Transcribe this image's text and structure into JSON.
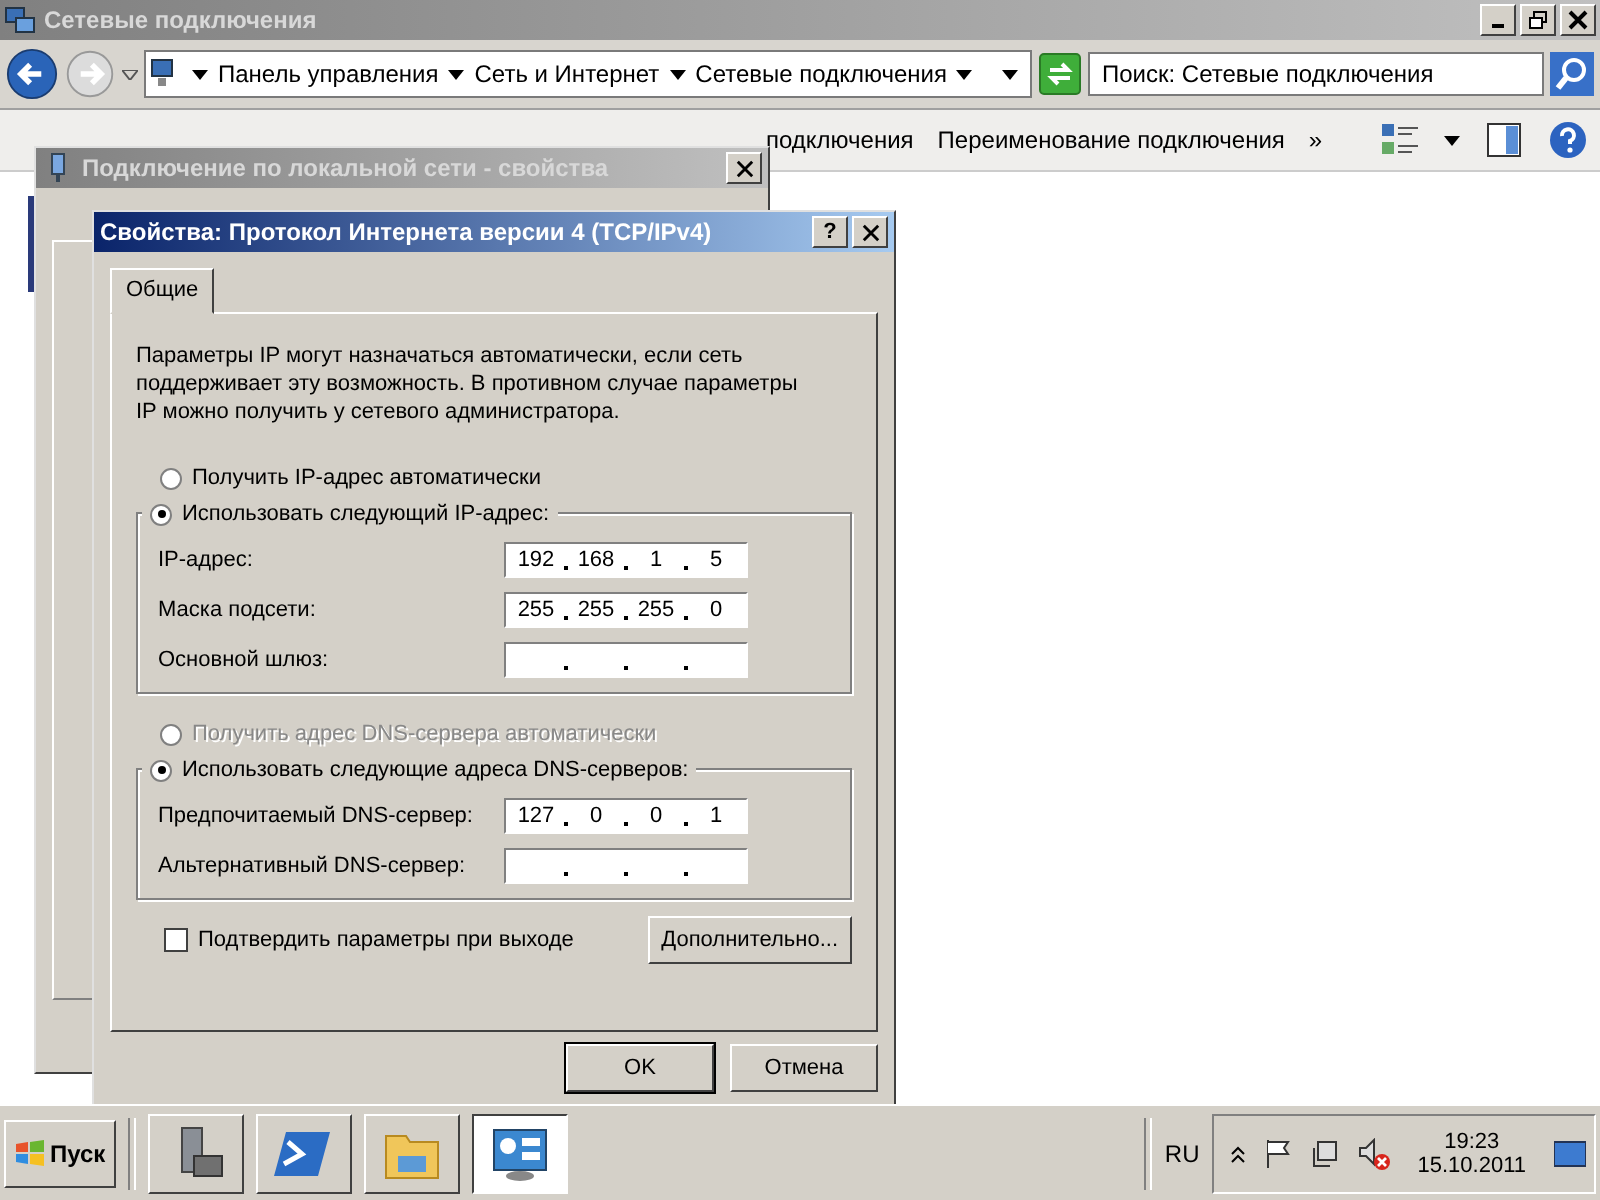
{
  "explorer": {
    "title": "Сетевые подключения",
    "breadcrumb": [
      "Панель управления",
      "Сеть и Интернет",
      "Сетевые подключения"
    ],
    "search": {
      "placeholder": "Поиск: Сетевые подключения"
    },
    "toolbar": [
      "подключения",
      "Переименование подключения"
    ],
    "overflow": "»"
  },
  "back_dialog": {
    "title": "Подключение по локальной сети - свойства"
  },
  "dialog": {
    "title": "Свойства: Протокол Интернета версии 4 (TCP/IPv4)",
    "help": "?",
    "tabs": [
      {
        "label": "Общие",
        "selected": true
      }
    ],
    "description": "Параметры IP могут назначаться автоматически, если сеть поддерживает эту возможность. В противном случае параметры IP можно получить у сетевого администратора.",
    "ip_modes": [
      {
        "label": "Получить IP-адрес автоматически",
        "selected": false,
        "disabled": false
      },
      {
        "label": "Использовать следующий IP-адрес:",
        "selected": true,
        "disabled": false
      }
    ],
    "ip_fields": [
      {
        "label": "IP-адрес:",
        "octets": [
          "192",
          "168",
          "1",
          "5"
        ]
      },
      {
        "label": "Маска подсети:",
        "octets": [
          "255",
          "255",
          "255",
          "0"
        ]
      },
      {
        "label": "Основной шлюз:"
      }
    ],
    "dns_modes": [
      {
        "label": "Получить адрес DNS-сервера автоматически",
        "selected": false,
        "disabled": true
      },
      {
        "label": "Использовать следующие адреса DNS-серверов:",
        "selected": true,
        "disabled": false
      }
    ],
    "dns_fields": [
      {
        "label": "Предпочитаемый DNS-сервер:",
        "octets": [
          "127",
          "0",
          "0",
          "1"
        ]
      },
      {
        "label": "Альтернативный DNS-сервер:"
      }
    ],
    "confirm": {
      "label": "Подтвердить параметры при выходе",
      "checked": false
    },
    "advanced": "Дополнительно...",
    "buttons": [
      "OK",
      "Отмена"
    ]
  },
  "taskbar": {
    "start": "Пуск",
    "apps": [
      {
        "kind": "server",
        "selected": false
      },
      {
        "kind": "shell",
        "selected": false
      },
      {
        "kind": "folder",
        "selected": false
      },
      {
        "kind": "panel",
        "selected": true
      }
    ],
    "language": "RU",
    "time": "19:23",
    "date": "15.10.2011"
  }
}
